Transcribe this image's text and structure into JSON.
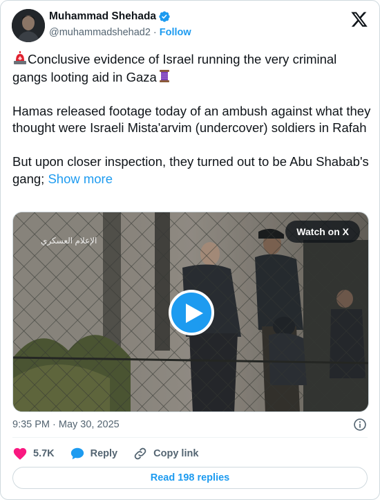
{
  "author": {
    "display_name": "Muhammad Shehada",
    "handle": "@muhammadshehad2",
    "follow_label": "Follow"
  },
  "tweet": {
    "line1": "Conclusive evidence of Israel running the very criminal",
    "line2": "gangs looting aid in Gaza",
    "para2": "Hamas released footage today of an ambush against what they thought were Israeli Mista'arvim (undercover) soldiers in Rafah",
    "para3": "But upon closer inspection, they turned out to be Abu Shabab's gang;",
    "show_more": "Show more"
  },
  "media": {
    "watch_label": "Watch on X",
    "watermark": "الإعلام العسكري"
  },
  "timestamp": "9:35 PM · May 30, 2025",
  "actions": {
    "likes": "5.7K",
    "reply_label": "Reply",
    "copy_label": "Copy link"
  },
  "read_replies": "Read 198 replies",
  "colors": {
    "accent": "#1d9bf0",
    "like": "#f91880",
    "secondary_text": "#536471"
  }
}
